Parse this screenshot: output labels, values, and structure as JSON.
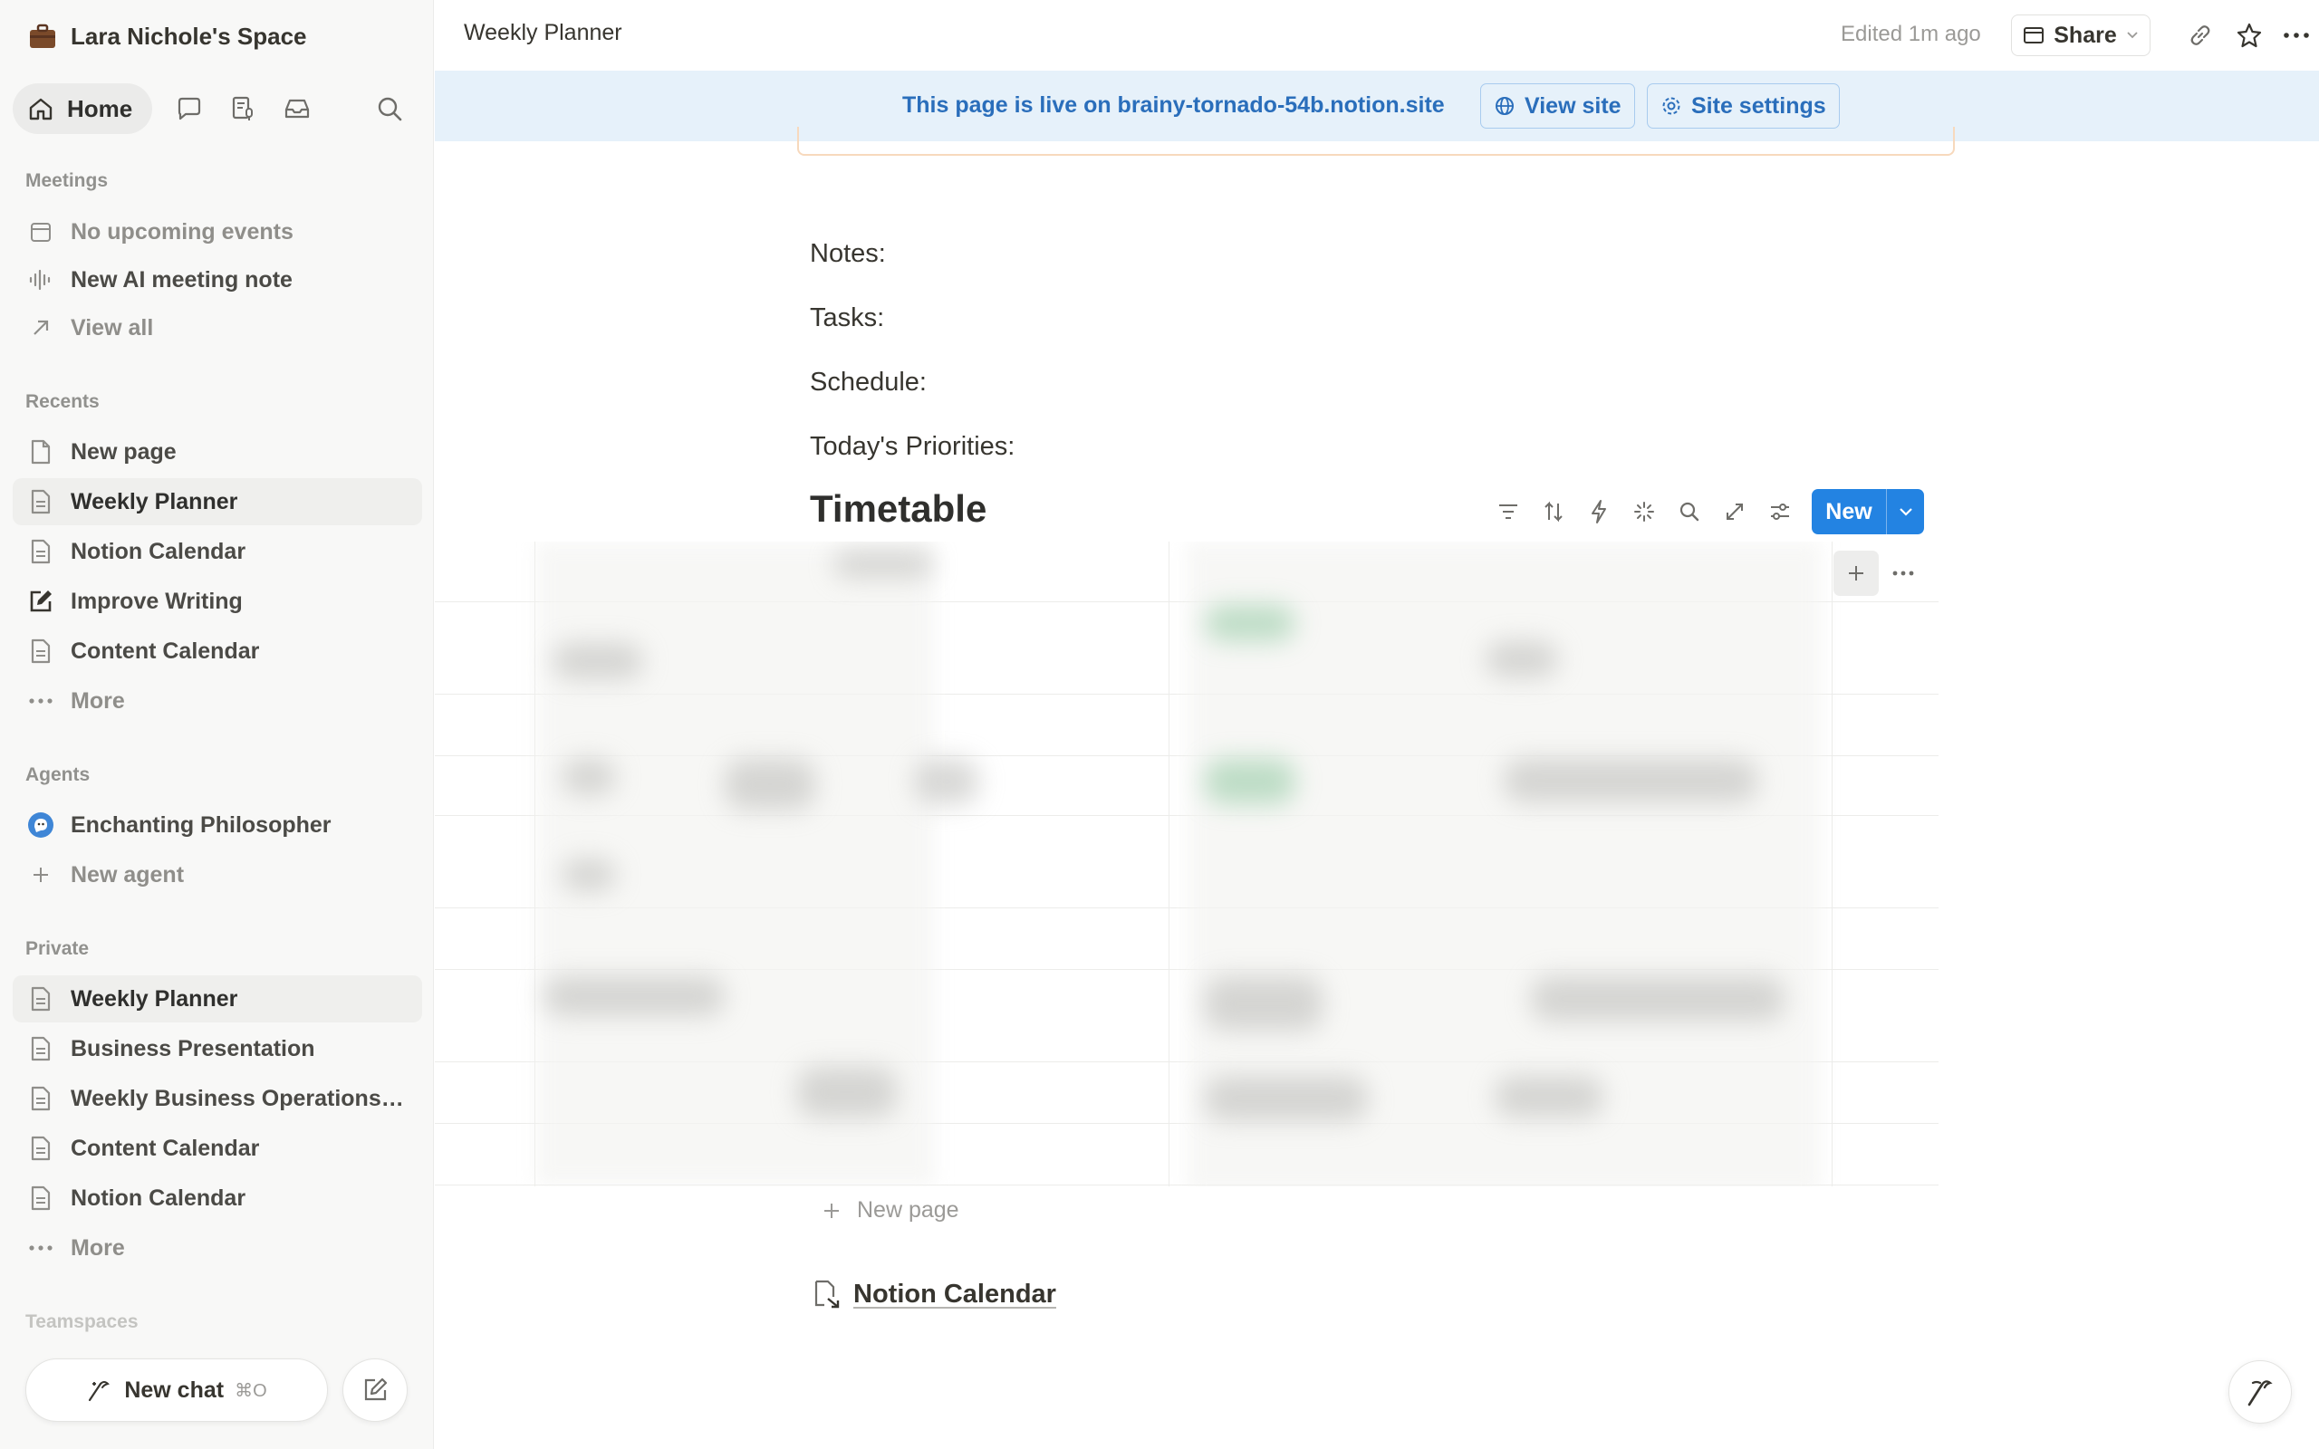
{
  "workspace": {
    "name": "Lara Nichole's Space"
  },
  "nav": {
    "home_label": "Home"
  },
  "sections": {
    "meetings": "Meetings",
    "recents": "Recents",
    "agents": "Agents",
    "private": "Private",
    "teamspaces": "Teamspaces"
  },
  "meetings": [
    {
      "label": "No upcoming events",
      "icon": "calendar-icon"
    },
    {
      "label": "New AI meeting note",
      "icon": "waveform-icon"
    },
    {
      "label": "View all",
      "icon": "arrow-up-right-icon"
    }
  ],
  "recents": [
    {
      "label": "New page",
      "icon": "page-icon"
    },
    {
      "label": "Weekly Planner",
      "icon": "page-lines-icon"
    },
    {
      "label": "Notion Calendar",
      "icon": "page-lines-icon"
    },
    {
      "label": "Improve Writing",
      "icon": "edit-icon"
    },
    {
      "label": "Content Calendar",
      "icon": "page-lines-icon"
    },
    {
      "label": "More",
      "icon": "ellipsis-icon"
    }
  ],
  "agents": [
    {
      "label": "Enchanting Philosopher",
      "icon": "agent-avatar-icon"
    },
    {
      "label": "New agent",
      "icon": "plus-icon"
    }
  ],
  "private": [
    {
      "label": "Weekly Planner",
      "icon": "page-lines-icon"
    },
    {
      "label": "Business Presentation",
      "icon": "page-lines-icon"
    },
    {
      "label": "Weekly Business Operations ...",
      "icon": "page-lines-icon"
    },
    {
      "label": "Content Calendar",
      "icon": "page-lines-icon"
    },
    {
      "label": "Notion Calendar",
      "icon": "page-lines-icon"
    },
    {
      "label": "More",
      "icon": "ellipsis-icon"
    }
  ],
  "bottom": {
    "new_chat_label": "New chat",
    "new_chat_shortcut": "⌘O"
  },
  "topbar": {
    "page_title": "Weekly Planner",
    "edited": "Edited 1m ago",
    "share_label": "Share"
  },
  "banner": {
    "text": "This page is live on brainy-tornado-54b.notion.site",
    "view_site": "View site",
    "site_settings": "Site settings"
  },
  "content": {
    "lines": [
      "Notes:",
      "Tasks:",
      "Schedule:",
      "Today's Priorities:"
    ],
    "database_title": "Timetable",
    "new_button": "New",
    "new_page": "New page",
    "linked_page": "Notion Calendar"
  },
  "colors": {
    "accent": "#2383e2",
    "banner_bg": "#e6f1fa",
    "banner_text": "#2a6ebb",
    "sidebar_bg": "#f8f8f7"
  }
}
